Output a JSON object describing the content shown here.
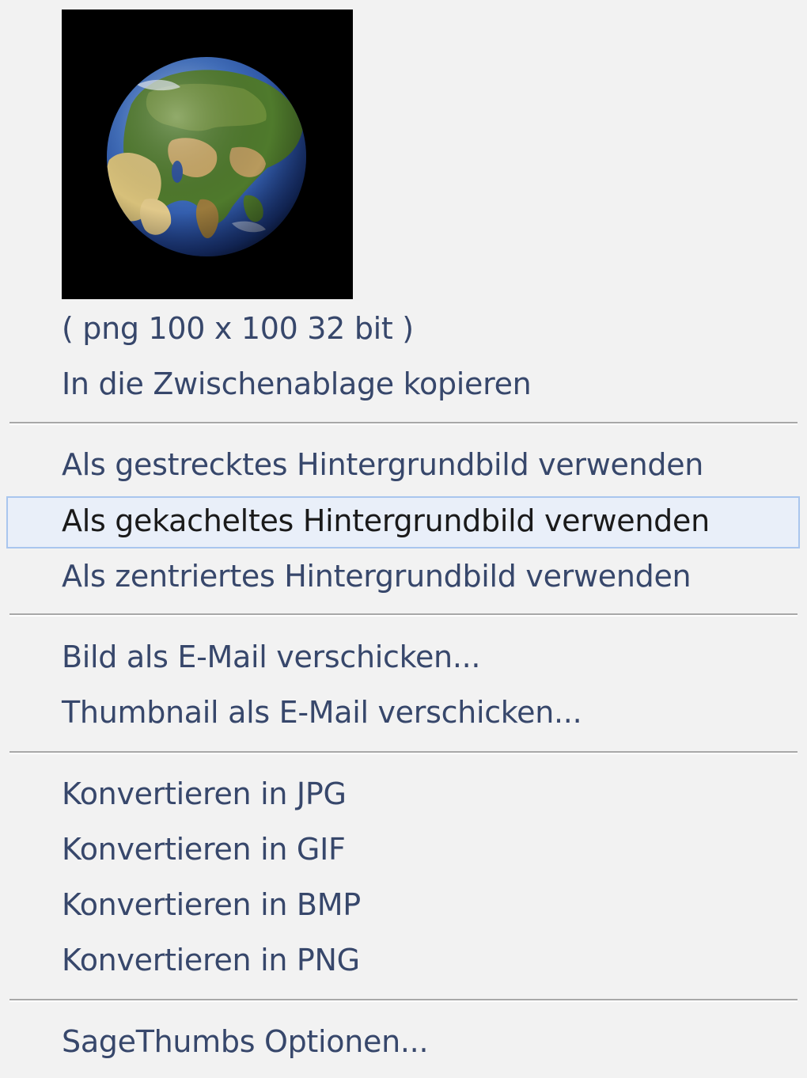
{
  "context_menu": {
    "image_info": "( png 100 x 100 32 bit )",
    "copy_to_clipboard": "In die Zwischenablage kopieren",
    "wallpaper": {
      "stretched": "Als gestrecktes Hintergrundbild verwenden",
      "tiled": "Als gekacheltes Hintergrundbild verwenden",
      "centered": "Als zentriertes Hintergrundbild verwenden"
    },
    "email": {
      "image": "Bild als E-Mail verschicken...",
      "thumbnail": "Thumbnail als E-Mail verschicken..."
    },
    "convert": {
      "jpg": "Konvertieren in JPG",
      "gif": "Konvertieren in GIF",
      "bmp": "Konvertieren in BMP",
      "png": "Konvertieren in PNG"
    },
    "options": "SageThumbs Optionen...",
    "highlighted_item": "Als gekacheltes Hintergrundbild verwenden"
  },
  "thumbnail": {
    "icon": "globe-icon"
  },
  "colors": {
    "menu_background": "#f2f2f2",
    "text": "#37476b",
    "highlight_fill": "#e9eff9",
    "highlight_border": "#a9c6ee"
  }
}
